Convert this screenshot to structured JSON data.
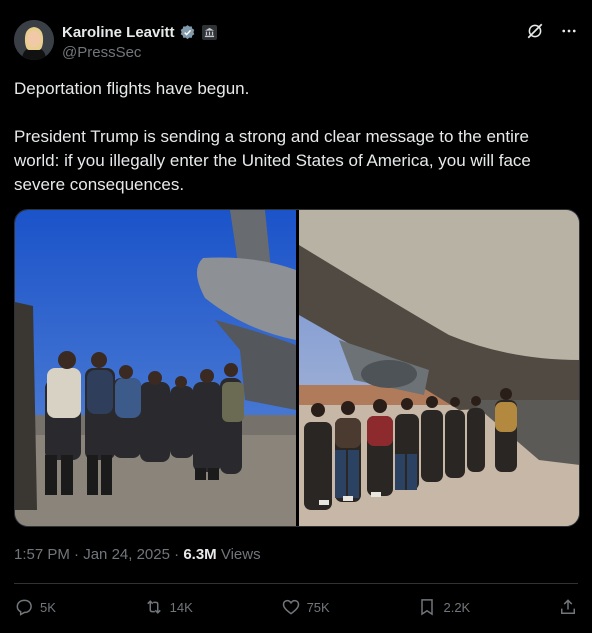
{
  "author": {
    "display_name": "Karoline Leavitt",
    "handle": "@PressSec",
    "verified": true
  },
  "icons": {
    "grok": "grok-icon",
    "more": "more-icon",
    "verified": "verified-badge-icon",
    "gov": "government-badge-icon"
  },
  "tweet": {
    "line1": "Deportation flights have begun.",
    "line2": "President Trump is sending a strong and clear message to the entire world: if you illegally enter the United States of America, you will face severe consequences."
  },
  "meta": {
    "time": "1:57 PM",
    "date": "Jan 24, 2025",
    "views_count": "6.3M",
    "views_label": "Views"
  },
  "actions": {
    "replies": "5K",
    "reposts": "14K",
    "likes": "75K",
    "bookmarks": "2.2K"
  },
  "colors": {
    "background": "#000000",
    "text": "#e7e9ea",
    "muted": "#71767b",
    "verified": "#829aab"
  }
}
